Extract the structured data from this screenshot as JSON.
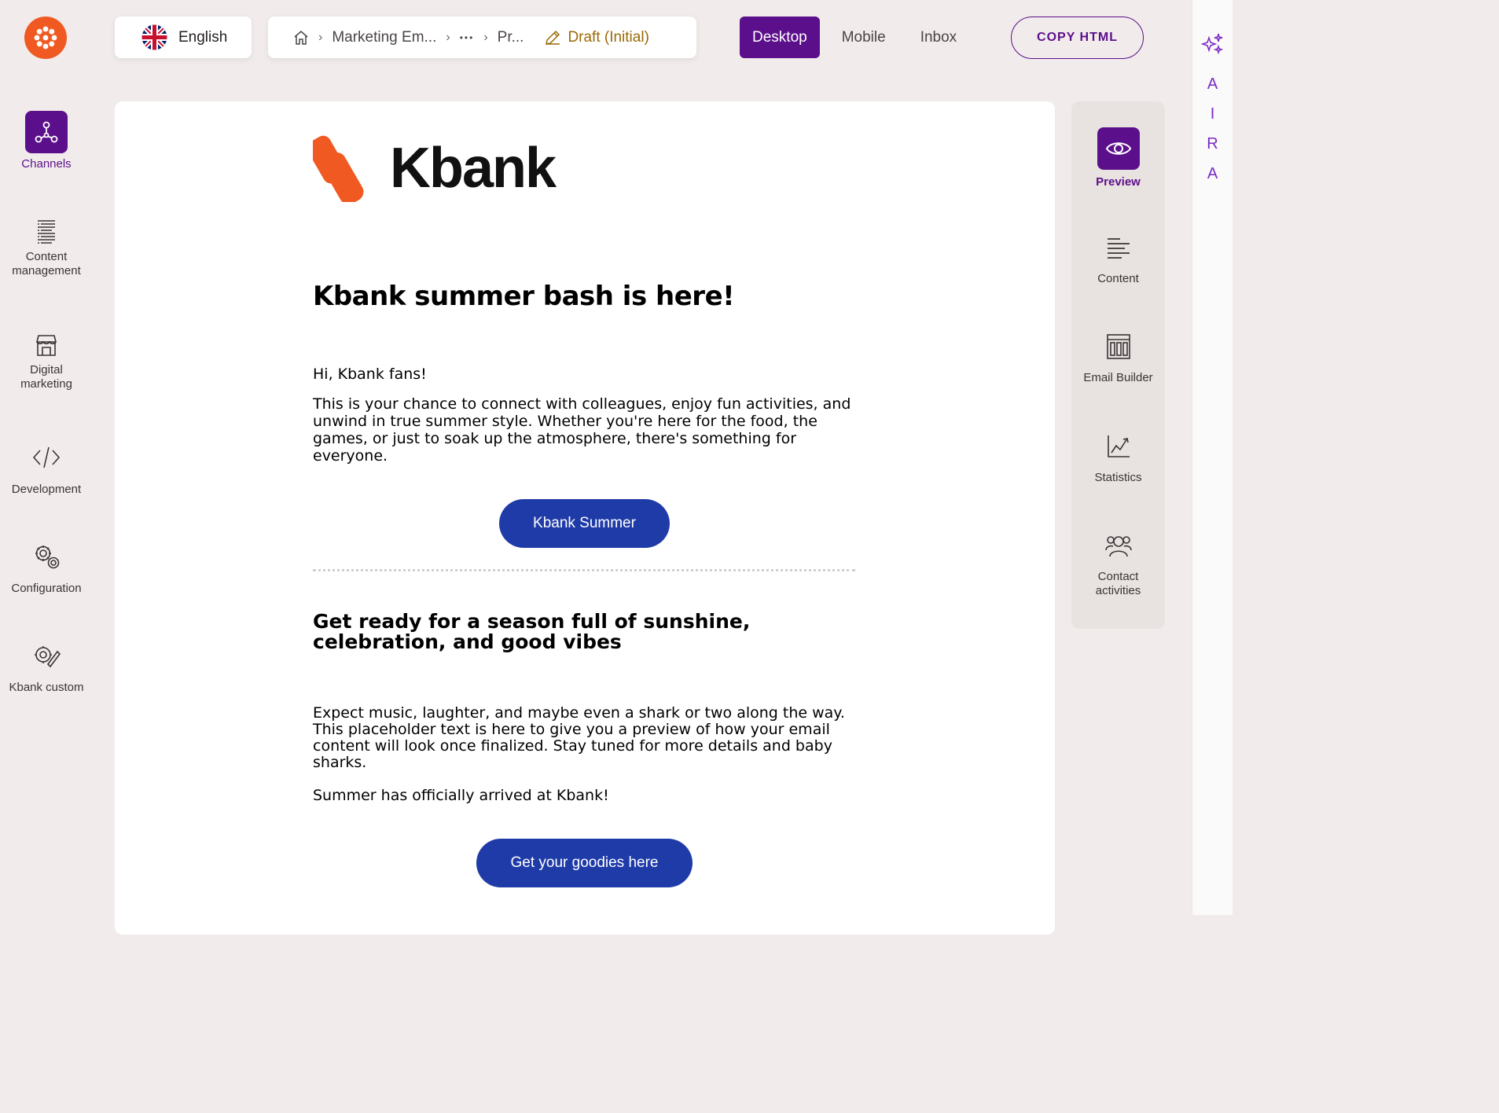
{
  "app": {
    "brand_color": "#5c0f8b",
    "logo_color": "#f05a22"
  },
  "left_nav": {
    "items": [
      {
        "label": "Channels",
        "icon": "channels-icon",
        "active": true
      },
      {
        "label": "Content\nmanagement",
        "icon": "content-management-icon"
      },
      {
        "label": "Digital\nmarketing",
        "icon": "digital-marketing-icon"
      },
      {
        "label": "Development",
        "icon": "code-icon"
      },
      {
        "label": "Configuration",
        "icon": "gears-icon"
      },
      {
        "label": "Kbank custom",
        "icon": "custom-gear-icon"
      }
    ]
  },
  "topbar": {
    "language": "English",
    "breadcrumb": {
      "items": [
        "Marketing Em...",
        "•••",
        "Pr..."
      ],
      "status": "Draft (Initial)"
    },
    "view_tabs": [
      "Desktop",
      "Mobile",
      "Inbox"
    ],
    "active_view": "Desktop",
    "copy_button": "COPY HTML"
  },
  "tool_panel": {
    "items": [
      {
        "label": "Preview",
        "icon": "eye-icon",
        "active": true
      },
      {
        "label": "Content",
        "icon": "content-lines-icon"
      },
      {
        "label": "Email Builder",
        "icon": "email-builder-icon"
      },
      {
        "label": "Statistics",
        "icon": "statistics-icon"
      },
      {
        "label": "Contact\nactivities",
        "icon": "contacts-icon"
      }
    ]
  },
  "aira": {
    "letters": [
      "A",
      "I",
      "R",
      "A"
    ]
  },
  "email": {
    "brand_name": "Kbank",
    "heading": "Kbank summer bash is here!",
    "greeting": "Hi, Kbank fans!",
    "paragraph1": "This is your chance to connect with colleagues, enjoy fun activities, and unwind in true summer style. Whether you're here for the food, the games, or just to soak up the atmosphere, there's something for everyone.",
    "button1": "Kbank Summer",
    "subheading": "Get ready for a season full of sunshine, celebration, and good vibes",
    "paragraph2": "Expect music, laughter, and maybe even a shark or two along the way. This placeholder text is here to give you a preview of how your email content will look once finalized. Stay tuned for more details and baby sharks.",
    "paragraph3": "Summer has officially arrived at Kbank!",
    "button2": "Get your goodies here",
    "button_color": "#1f3ba8",
    "brand_mark_color": "#f05a22"
  }
}
